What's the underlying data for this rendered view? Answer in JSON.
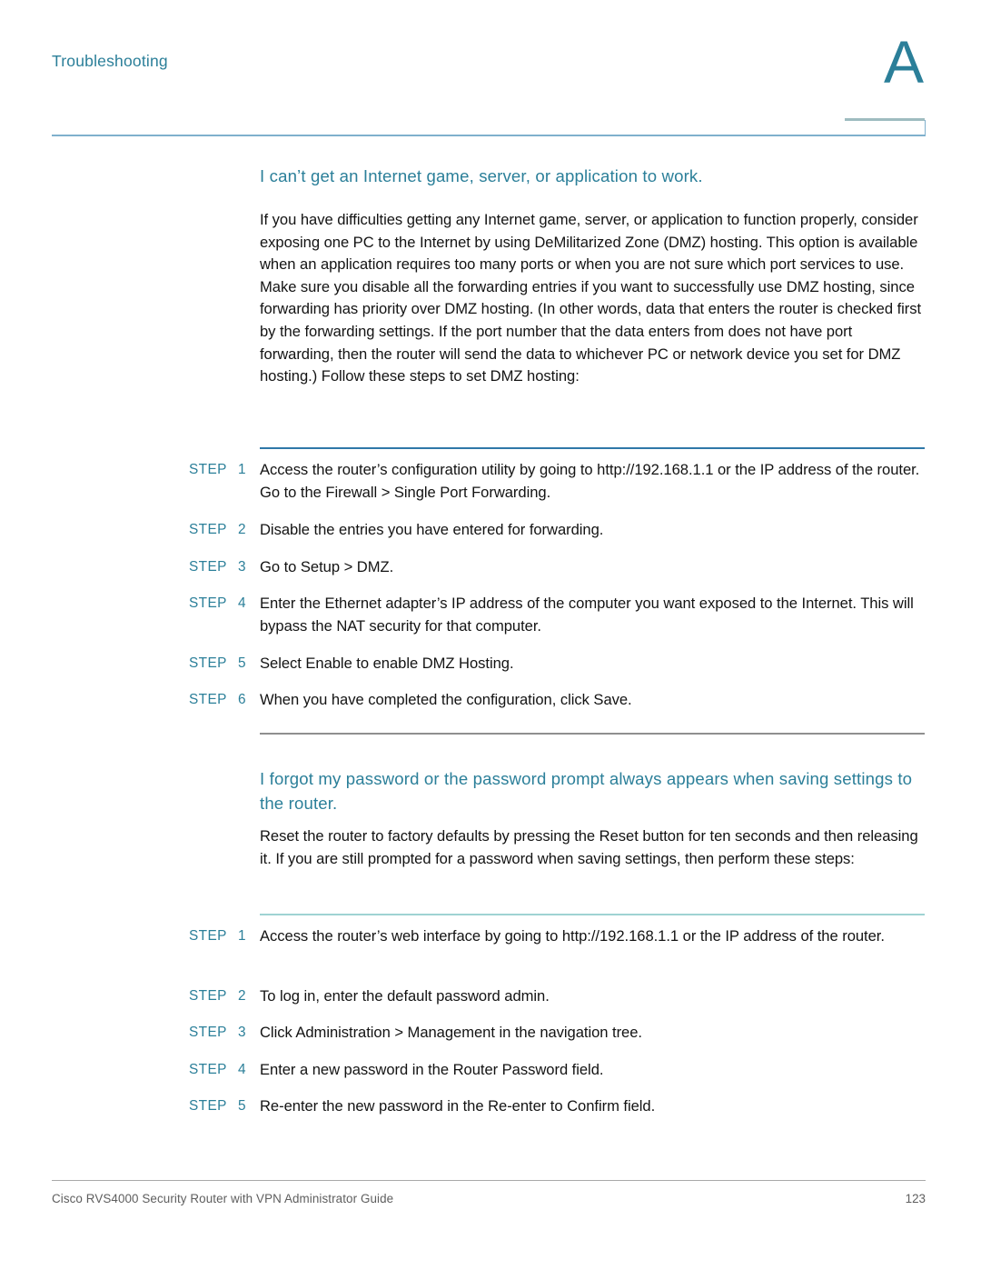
{
  "document": {
    "running_header": "Troubleshooting",
    "chapter_letter": "A",
    "accent_color": "#2b7f99",
    "rule_blue": "#2f78a8",
    "rule_gray": "#8f8f8f",
    "rule_teal": "#9fd3d3"
  },
  "sections": [
    {
      "title": "I can’t get an Internet game, server, or application to work.",
      "intro": "If you have difficulties getting any Internet game, server, or application to function properly, consider exposing one PC to the Internet by using DeMilitarized Zone (DMZ) hosting. This option is available when an application requires too many ports or when you are not sure which port services to use. Make sure you disable all the forwarding entries if you want to successfully use DMZ hosting, since forwarding has priority over DMZ hosting. (In other words, data that enters the router is checked first by the forwarding settings. If the port number that the data enters from does not have port forwarding, then the router will send the data to whichever PC or network device you set for DMZ hosting.) Follow these steps to set DMZ hosting:",
      "steps": [
        {
          "label": "STEP",
          "num": "1",
          "text": "Access the router’s configuration utility by going to http://192.168.1.1 or the IP address of the router. Go to the Firewall > Single Port Forwarding."
        },
        {
          "label": "STEP",
          "num": "2",
          "text": "Disable the entries you have entered for forwarding."
        },
        {
          "label": "STEP",
          "num": "3",
          "text": "Go to Setup > DMZ."
        },
        {
          "label": "STEP",
          "num": "4",
          "text": "Enter the Ethernet adapter’s IP address of the computer you want exposed to the Internet. This will bypass the NAT security for that computer."
        },
        {
          "label": "STEP",
          "num": "5",
          "text": "Select Enable to enable DMZ Hosting."
        },
        {
          "label": "STEP",
          "num": "6",
          "text": "When you have completed the configuration, click Save."
        }
      ]
    },
    {
      "title": "I forgot my password or the password prompt always appears when saving settings to the router.",
      "intro": "Reset the router to factory defaults by pressing the Reset button for ten seconds and then releasing it. If you are still prompted for a password when saving settings, then perform these steps:",
      "steps": [
        {
          "label": "STEP",
          "num": "1",
          "text": "Access the router’s web interface by going to http://192.168.1.1 or the IP address of the router."
        },
        {
          "label": "STEP",
          "num": "2",
          "text": "To log in, enter the default password admin."
        },
        {
          "label": "STEP",
          "num": "3",
          "text": "Click Administration > Management in the navigation tree."
        },
        {
          "label": "STEP",
          "num": "4",
          "text": "Enter a new password in the Router Password field."
        },
        {
          "label": "STEP",
          "num": "5",
          "text": "Re-enter the new password in the Re-enter to Confirm field."
        }
      ]
    }
  ],
  "footer": {
    "title": "Cisco RVS4000 Security Router with VPN Administrator Guide",
    "page_number": "123"
  }
}
